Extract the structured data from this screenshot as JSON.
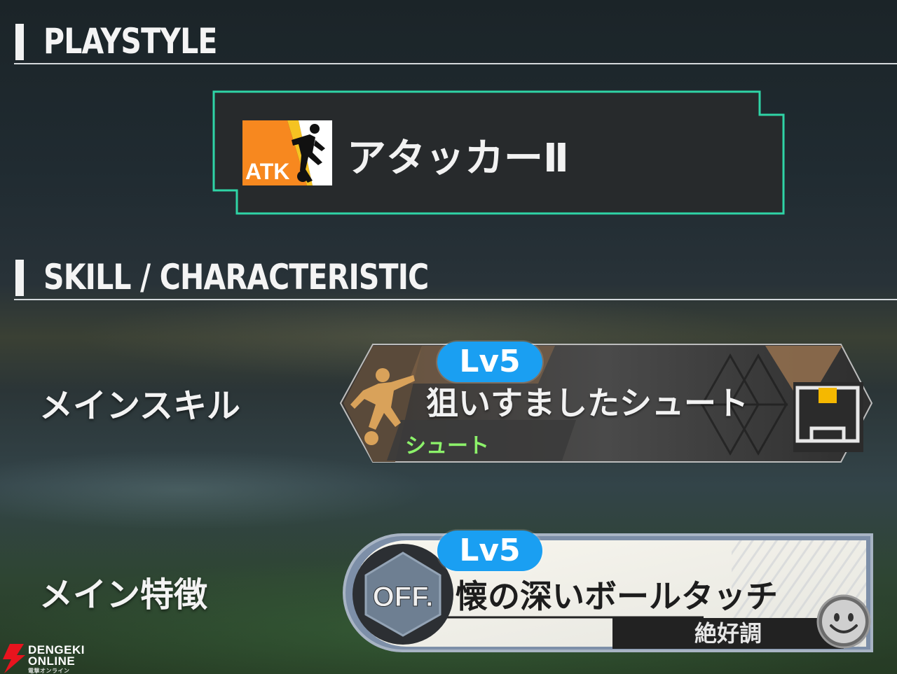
{
  "sections": {
    "playstyle_title": "PLAYSTYLE",
    "skill_title": "SKILL / CHARACTERISTIC"
  },
  "playstyle": {
    "badge_text": "ATK",
    "name": "アタッカーⅡ",
    "icon": "attacker-icon",
    "frame_color": "#2fd4a6"
  },
  "main_skill": {
    "label": "メインスキル",
    "level": "Lv5",
    "name": "狙いすましたシュート",
    "category": "シュート",
    "icon": "kicker-icon",
    "target_icon": "goal-target-icon",
    "level_color": "#1a9ff2",
    "category_color": "#8cf26a"
  },
  "main_trait": {
    "label": "メイン特徴",
    "level": "Lv5",
    "name": "懐の深いボールタッチ",
    "condition": "絶好調",
    "emblem_text": "OFF.",
    "condition_icon": "smile-icon"
  },
  "watermark": {
    "line1": "DENGEKI",
    "line2": "ONLINE",
    "line3": "電撃オンライン"
  }
}
